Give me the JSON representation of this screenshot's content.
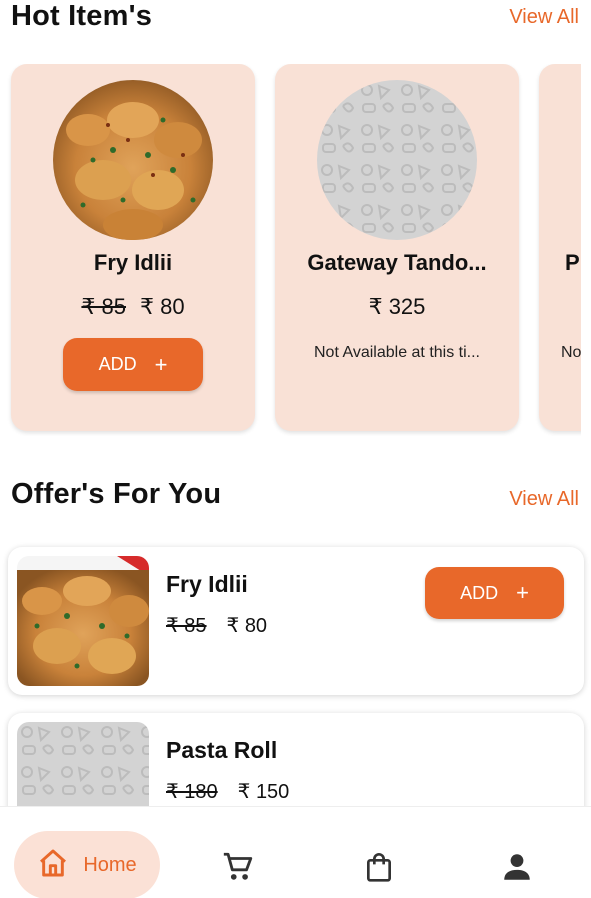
{
  "hot_items": {
    "title": "Hot Item's",
    "view_all": "View All",
    "items": [
      {
        "name": "Fry Idlii",
        "old_price": "₹ 85",
        "price": "₹ 80",
        "add_label": "ADD",
        "add_icon": "+",
        "image": "fry-idli-photo"
      },
      {
        "name": "Gateway Tando...",
        "price": "₹ 325",
        "status": "Not Available at this ti...",
        "image": "placeholder-food-pattern"
      },
      {
        "name": "P",
        "status": "No",
        "image": "placeholder-food-pattern"
      }
    ]
  },
  "offers": {
    "title": "Offer's For You",
    "view_all": "View All",
    "items": [
      {
        "name": "Fry Idlii",
        "old_price": "₹ 85",
        "price": "₹ 80",
        "add_label": "ADD",
        "add_icon": "+",
        "image": "fry-idli-photo"
      },
      {
        "name": "Pasta Roll",
        "old_price": "₹ 180",
        "price": "₹ 150",
        "image": "placeholder-food-pattern"
      }
    ]
  },
  "nav": {
    "home_label": "Home",
    "icons": [
      "home-icon",
      "cart-icon",
      "shopping-bag-icon",
      "profile-icon"
    ]
  },
  "colors": {
    "accent": "#e8682a",
    "card_bg": "#f9e1d6",
    "nav_active_bg": "#fbe1d6"
  }
}
